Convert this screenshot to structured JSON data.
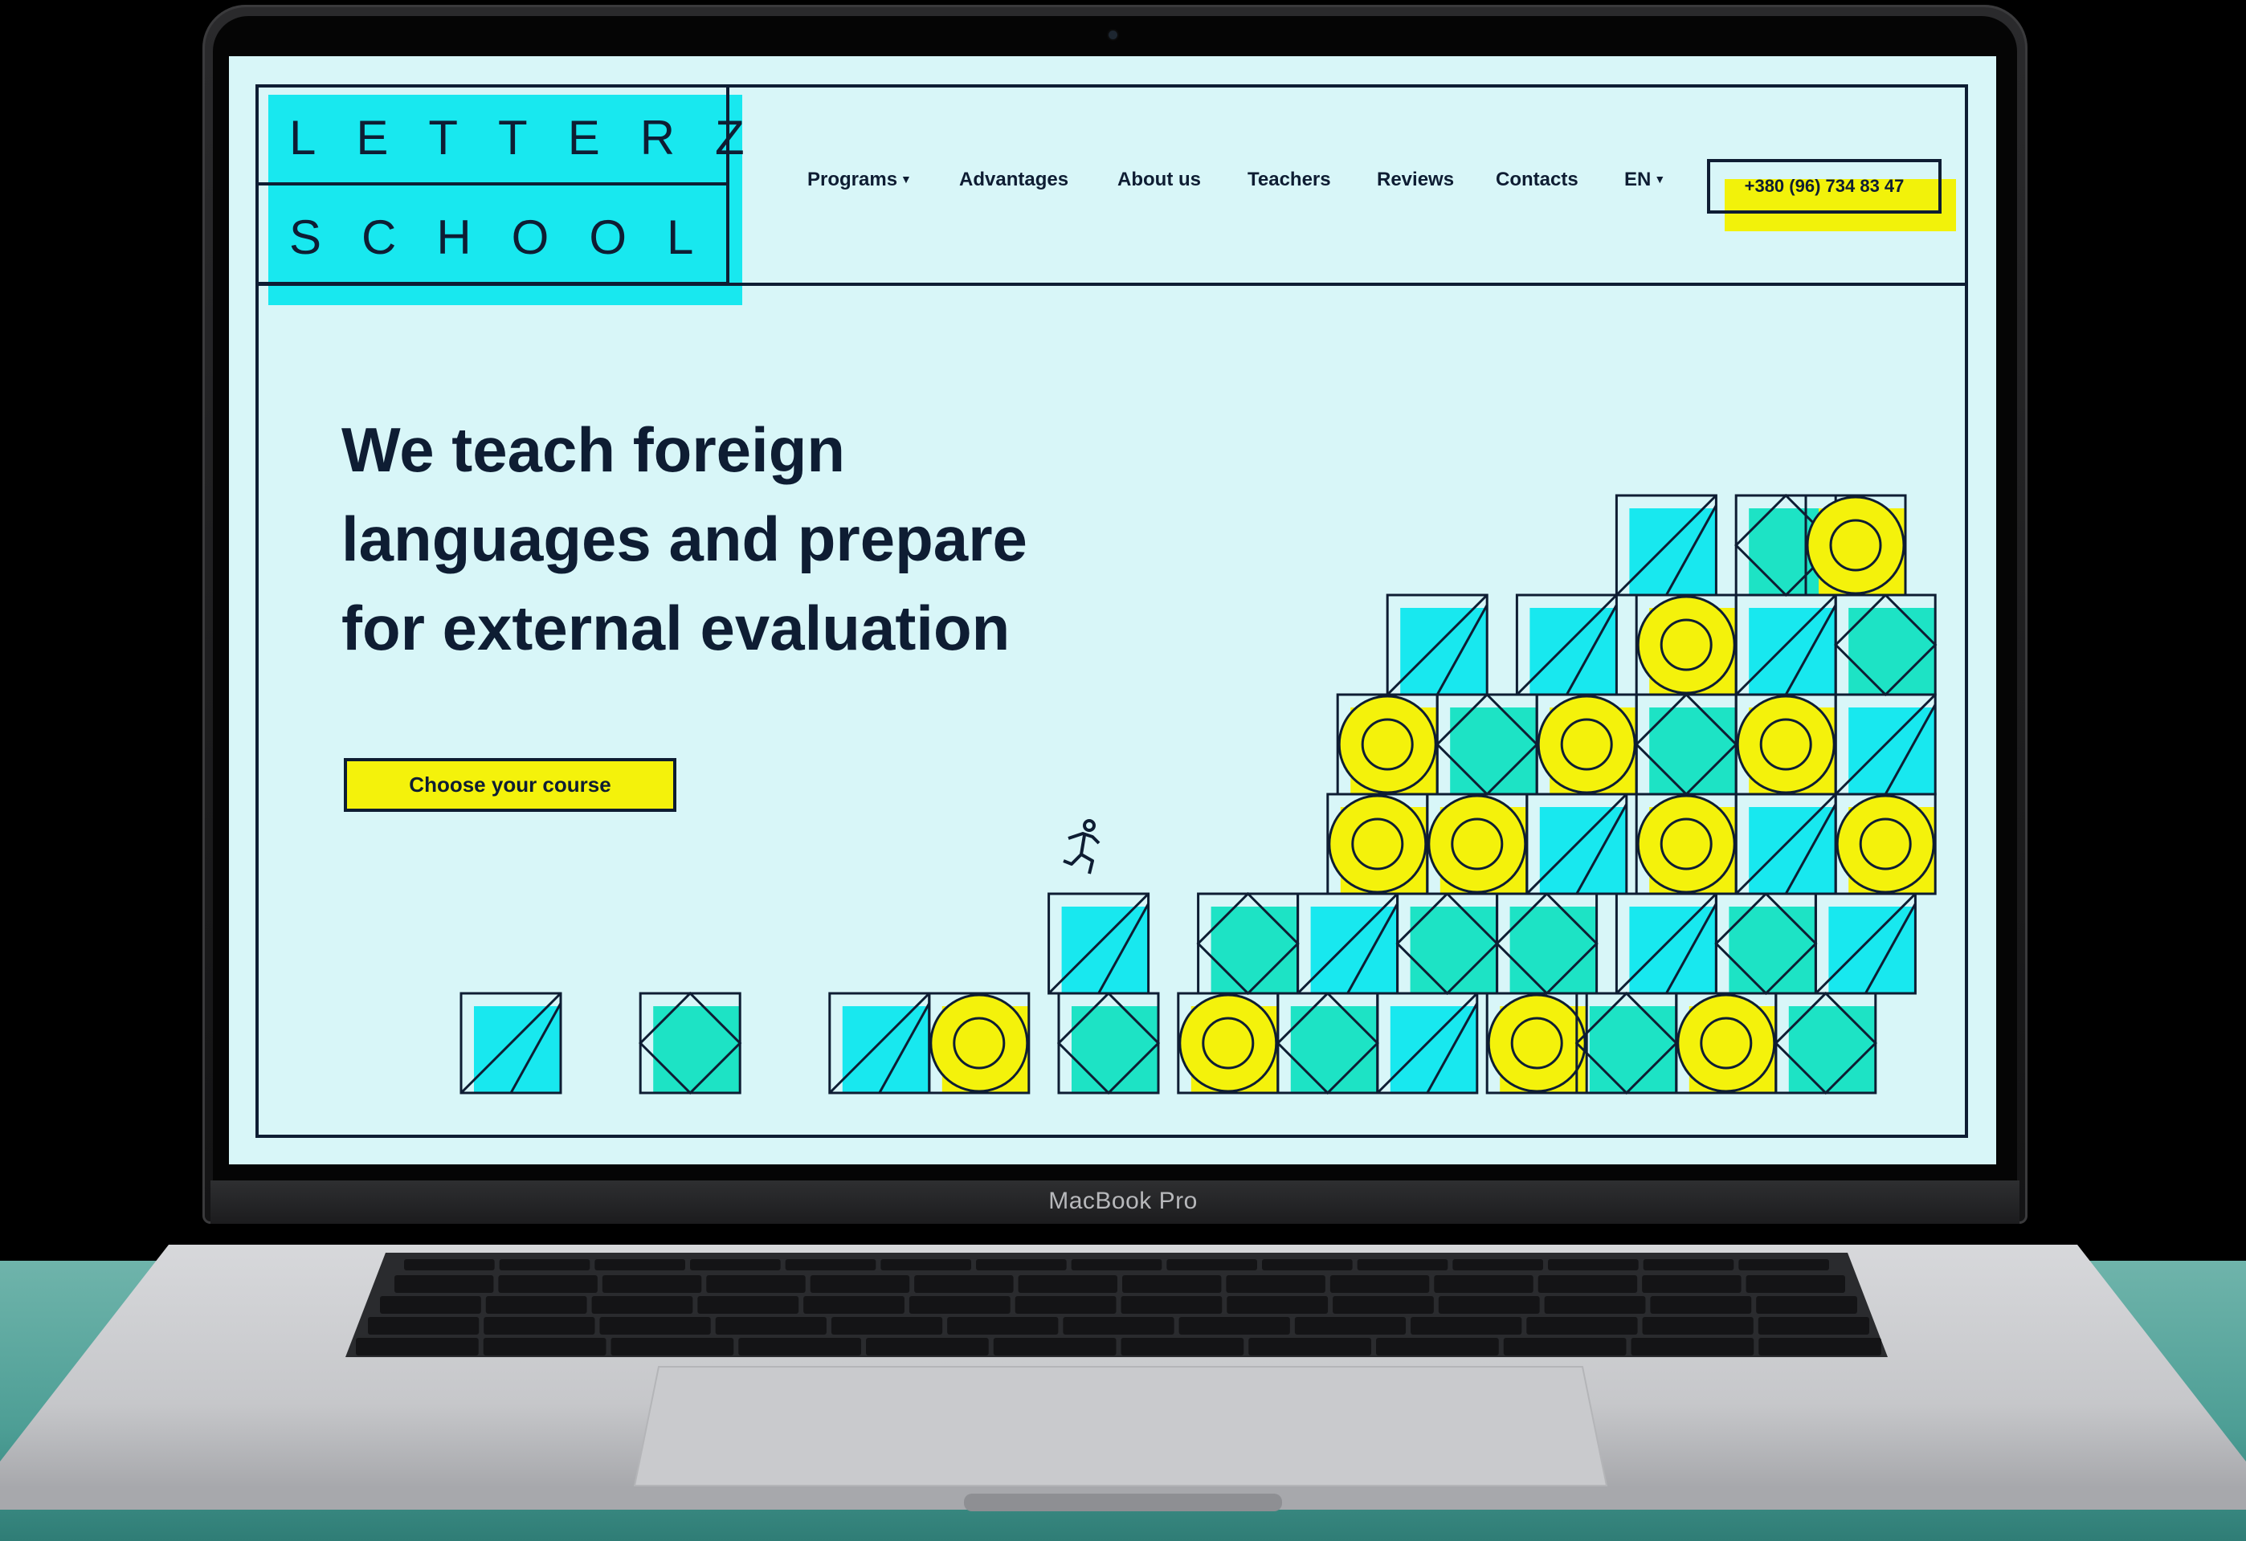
{
  "device": {
    "label": "MacBook Pro"
  },
  "site": {
    "logo": {
      "line1": "LETTERZ",
      "line2": "SCHOOL"
    },
    "nav": [
      {
        "label": "Programs",
        "dropdown": true
      },
      {
        "label": "Advantages",
        "dropdown": false
      },
      {
        "label": "About us",
        "dropdown": false
      },
      {
        "label": "Teachers",
        "dropdown": false
      },
      {
        "label": "Reviews",
        "dropdown": false
      },
      {
        "label": "Contacts",
        "dropdown": false
      },
      {
        "label": "EN",
        "dropdown": true
      }
    ],
    "phone": "+380 (96) 734 83 47",
    "hero": {
      "title_line1": "We teach foreign",
      "title_line2": "languages and prepare",
      "title_line3": "for external evaluation",
      "cta": "Choose your course"
    },
    "icons": {
      "runner": "running-person-icon",
      "caret": "chevron-down-icon"
    },
    "colors": {
      "background": "#d8f6f8",
      "cyan": "#18e8ef",
      "teal": "#1de3c5",
      "yellow": "#f4f20b",
      "ink": "#0e1d33"
    }
  }
}
